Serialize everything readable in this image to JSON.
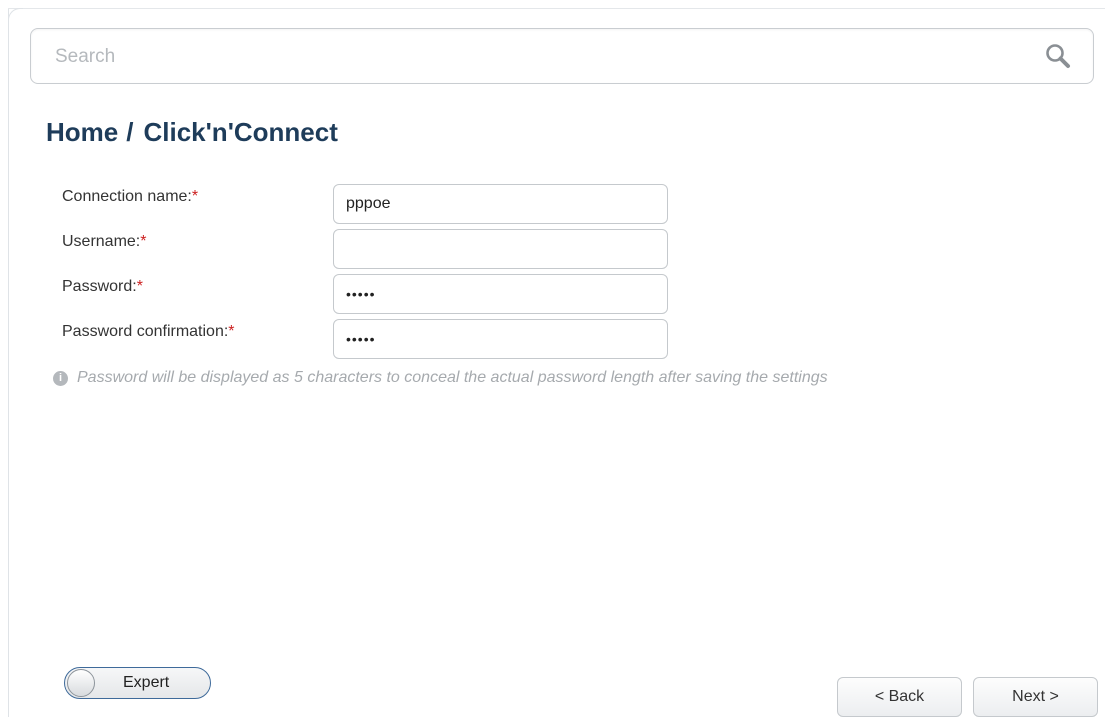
{
  "search": {
    "placeholder": "Search",
    "icon": "search-icon"
  },
  "breadcrumb": {
    "home": "Home",
    "separator": "/",
    "current": "Click'n'Connect"
  },
  "form": {
    "fields": [
      {
        "label": "Connection name:",
        "required": "*",
        "value": "pppoe"
      },
      {
        "label": "Username:",
        "required": "*",
        "value": ""
      },
      {
        "label": "Password:",
        "required": "*",
        "value": "•••••"
      },
      {
        "label": "Password confirmation:",
        "required": "*",
        "value": "•••••"
      }
    ],
    "hint": "Password will be displayed as 5 characters to conceal the actual password length after saving the settings",
    "hint_icon": "info-icon"
  },
  "footer": {
    "expert_label": "Expert",
    "expert_on": false,
    "back_label": "< Back",
    "next_label": "Next >"
  },
  "colors": {
    "title": "#1e3c5a",
    "required": "#cc1f1f",
    "toggle_border": "#3e6a9a"
  }
}
